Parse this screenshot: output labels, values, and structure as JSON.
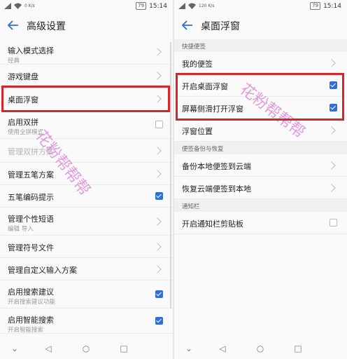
{
  "status": {
    "left": {
      "net_speed": "0 K/s",
      "speed_right": "120 K/s"
    },
    "battery": "79",
    "time": "15:14"
  },
  "left_panel": {
    "title": "高级设置",
    "items": [
      {
        "label": "输入模式选择",
        "sub": "经典",
        "control": "chevron"
      },
      {
        "label": "游戏键盘",
        "control": "chevron"
      },
      {
        "label": "桌面浮窗",
        "control": "chevron",
        "highlighted": true
      },
      {
        "label": "启用双拼",
        "sub": "使用全拼模式",
        "control": "checkbox",
        "checked": false
      },
      {
        "label": "管理双拼方案",
        "control": "chevron",
        "disabled": true
      },
      {
        "label": "管理五笔方案",
        "control": "chevron"
      },
      {
        "label": "五笔编码提示",
        "control": "checkbox",
        "checked": true
      },
      {
        "label": "管理个性短语",
        "sub": "编辑  导入",
        "control": "chevron"
      },
      {
        "label": "管理符号文件",
        "control": "chevron"
      },
      {
        "label": "管理自定义输入方案",
        "control": "chevron"
      },
      {
        "label": "启用搜索建议",
        "sub": "开启搜索建议功能",
        "control": "checkbox",
        "checked": true
      },
      {
        "label": "启用智能搜索",
        "sub": "开启智能搜索",
        "control": "checkbox",
        "checked": true
      }
    ],
    "watermark": "花粉帮帮帮"
  },
  "right_panel": {
    "title": "桌面浮窗",
    "sections": [
      {
        "header": "快捷便签",
        "items": [
          {
            "label": "我的便签",
            "control": "chevron"
          },
          {
            "label": "开启桌面浮窗",
            "control": "checkbox",
            "checked": true,
            "highlighted": true
          },
          {
            "label": "屏幕侧滑打开浮窗",
            "control": "checkbox",
            "checked": true,
            "highlighted": true
          },
          {
            "label": "浮窗位置",
            "control": "chevron"
          }
        ]
      },
      {
        "header": "便签备份与恢复",
        "items": [
          {
            "label": "备份本地便签到云端",
            "control": "chevron"
          },
          {
            "label": "恢复云端便签到本地",
            "control": "chevron"
          }
        ]
      },
      {
        "header": "通知栏",
        "items": [
          {
            "label": "开启通知栏剪贴板",
            "control": "checkbox",
            "checked": false
          }
        ]
      }
    ],
    "watermark": "花粉帮帮帮"
  },
  "colors": {
    "accent": "#2f6fd6",
    "highlight": "#d3272b",
    "watermark": "#d97ad6"
  },
  "icons": [
    "back-arrow-icon",
    "chevron-right-icon",
    "checkbox-icon",
    "nav-down-icon",
    "nav-back-icon",
    "nav-home-icon",
    "nav-recents-icon",
    "wifi-icon",
    "signal-icon"
  ]
}
